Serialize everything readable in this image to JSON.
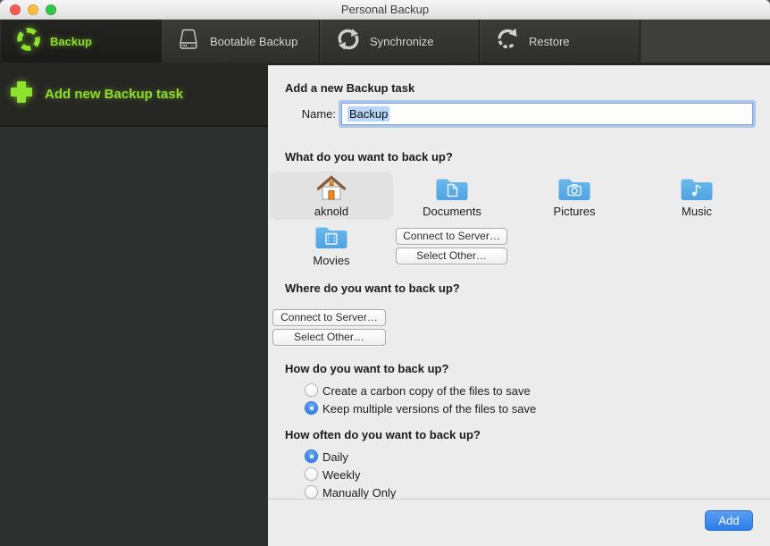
{
  "window": {
    "title": "Personal Backup"
  },
  "titlebar": {
    "traffic_lights": [
      "close-icon",
      "minimize-icon",
      "zoom-icon"
    ]
  },
  "toolbar": {
    "tabs": [
      {
        "label": "Backup",
        "icon": "backup-ring-icon",
        "active": true
      },
      {
        "label": "Bootable Backup",
        "icon": "drive-icon",
        "active": false
      },
      {
        "label": "Synchronize",
        "icon": "sync-arrows-icon",
        "active": false
      },
      {
        "label": "Restore",
        "icon": "restore-arrow-icon",
        "active": false
      }
    ]
  },
  "sidebar": {
    "add_task": {
      "label": "Add new Backup task",
      "icon": "plus-icon"
    }
  },
  "content": {
    "add_section": {
      "heading": "Add a new Backup task",
      "name_label": "Name:",
      "name_value": "Backup"
    },
    "what_section": {
      "heading": "What do you want to back up?",
      "sources": [
        {
          "label": "aknold",
          "icon": "home-icon",
          "selected": true
        },
        {
          "label": "Documents",
          "icon": "folder-documents-icon",
          "selected": false
        },
        {
          "label": "Pictures",
          "icon": "folder-pictures-icon",
          "selected": false
        },
        {
          "label": "Music",
          "icon": "folder-music-icon",
          "selected": false
        },
        {
          "label": "Movies",
          "icon": "folder-movies-icon",
          "selected": false
        }
      ],
      "connect_button": "Connect to Server…",
      "select_button": "Select Other…"
    },
    "where_section": {
      "heading": "Where do you want to back up?",
      "connect_button": "Connect to Server…",
      "select_button": "Select Other…"
    },
    "how_section": {
      "heading": "How do you want to back up?",
      "options": [
        {
          "label": "Create a carbon copy of the files to save",
          "selected": false
        },
        {
          "label": "Keep multiple versions of the files to save",
          "selected": true
        }
      ]
    },
    "often_section": {
      "heading": "How often do you want to back up?",
      "options": [
        {
          "label": "Daily",
          "selected": true
        },
        {
          "label": "Weekly",
          "selected": false
        },
        {
          "label": "Manually Only",
          "selected": false
        }
      ]
    },
    "footer": {
      "add_button": "Add"
    }
  },
  "colors": {
    "accent_green": "#8fdd2b",
    "text_selection_blue": "#b8d7fb",
    "primary_button_blue": "#2d7ce8",
    "folder_blue": "#5aace6",
    "content_background": "#ececec",
    "toolbar_dark": "#32322f",
    "sidebar_dark": "#2e302f"
  }
}
